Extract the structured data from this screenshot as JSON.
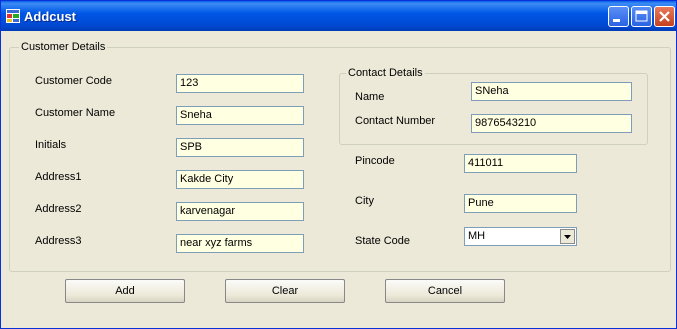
{
  "window": {
    "title": "Addcust"
  },
  "customer_details": {
    "title": "Customer Details",
    "customer_code": {
      "label": "Customer Code",
      "value": "123"
    },
    "customer_name": {
      "label": "Customer Name",
      "value": "Sneha"
    },
    "initials": {
      "label": "Initials",
      "value": "SPB"
    },
    "address1": {
      "label": "Address1",
      "value": "Kakde City"
    },
    "address2": {
      "label": "Address2",
      "value": "karvenagar"
    },
    "address3": {
      "label": "Address3",
      "value": "near xyz farms"
    }
  },
  "contact_details": {
    "title": "Contact Details",
    "name": {
      "label": "Name",
      "value": "SNeha"
    },
    "contact_number": {
      "label": "Contact Number",
      "value": "9876543210"
    }
  },
  "pincode": {
    "label": "Pincode",
    "value": "411011"
  },
  "city": {
    "label": "City",
    "value": "Pune"
  },
  "state_code": {
    "label": "State Code",
    "value": "MH"
  },
  "buttons": {
    "add": "Add",
    "clear": "Clear",
    "cancel": "Cancel"
  },
  "colors": {
    "titlebar": "#0058e6",
    "field_bg": "#ffffe1",
    "window_bg": "#ece9d8"
  }
}
